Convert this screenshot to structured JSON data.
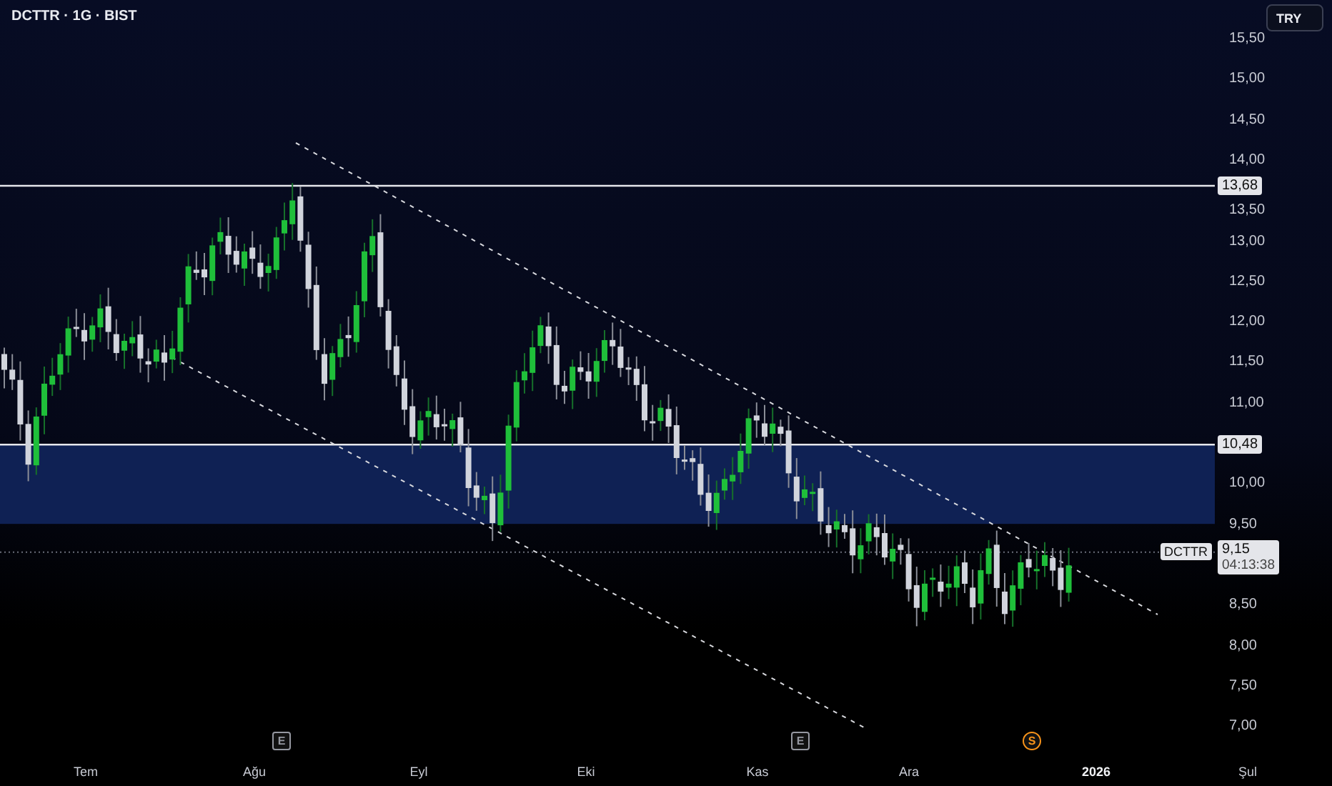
{
  "header": {
    "symbol_line": "DCTTR · 1G · BIST"
  },
  "currency_button": "TRY",
  "price_axis": {
    "ticks": [
      "15,50",
      "15,00",
      "14,50",
      "14,00",
      "13,50",
      "13,00",
      "12,50",
      "12,00",
      "11,50",
      "11,00",
      "10,00",
      "9,50",
      "8,50",
      "8,00",
      "7,50",
      "7,00"
    ]
  },
  "levels": [
    {
      "label": "13,68"
    },
    {
      "label": "10,48"
    }
  ],
  "last_price": {
    "symbol": "DCTTR",
    "price": "9,15",
    "countdown": "04:13:38"
  },
  "time_axis": {
    "labels": [
      {
        "text": "Tem",
        "kind": "month"
      },
      {
        "text": "Ağu",
        "kind": "month"
      },
      {
        "text": "Eyl",
        "kind": "month"
      },
      {
        "text": "Eki",
        "kind": "month"
      },
      {
        "text": "Kas",
        "kind": "month"
      },
      {
        "text": "Ara",
        "kind": "month"
      },
      {
        "text": "2026",
        "kind": "year"
      },
      {
        "text": "Şul",
        "kind": "month"
      }
    ]
  },
  "events": [
    {
      "glyph": "E",
      "kind": "earnings"
    },
    {
      "glyph": "E",
      "kind": "earnings"
    },
    {
      "glyph": "S",
      "kind": "split"
    }
  ]
}
